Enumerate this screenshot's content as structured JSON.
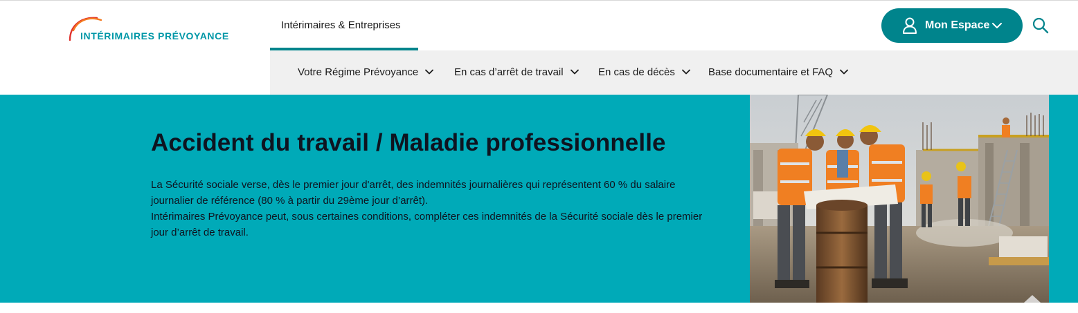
{
  "header": {
    "logo_text": "INTÉRIMAIRES PRÉVOYANCE",
    "main_tab": "Intérimaires & Entreprises",
    "account_button": "Mon Espace"
  },
  "subnav": {
    "items": [
      {
        "label": "Votre Régime Prévoyance"
      },
      {
        "label": "En cas d’arrêt de travail"
      },
      {
        "label": "En cas de décès"
      },
      {
        "label": "Base documentaire et FAQ"
      }
    ]
  },
  "hero": {
    "title": "Accident du travail / Maladie professionnelle",
    "paragraph_1": "La Sécurité sociale verse, dès le premier jour d'arrêt, des indemnités journalières qui représentent  60 % du salaire journalier de référence (80 % à partir du 29ème jour d’arrêt).",
    "paragraph_2": "Intérimaires Prévoyance peut, sous certaines conditions, compléter ces indemnités de la Sécurité sociale dès le premier jour d’arrêt de travail."
  },
  "colors": {
    "brand_teal": "#00848c",
    "hero_background": "#00aab8",
    "logo_text": "#0097a7",
    "logo_arc_orange": "#f47a20",
    "logo_arc_red": "#e0312d",
    "subnav_background": "#f0f0f0"
  },
  "icons": {
    "account": "user-icon",
    "account_dropdown": "chevron-down-icon",
    "search": "search-icon",
    "subnav_dropdown": "chevron-down-icon"
  }
}
